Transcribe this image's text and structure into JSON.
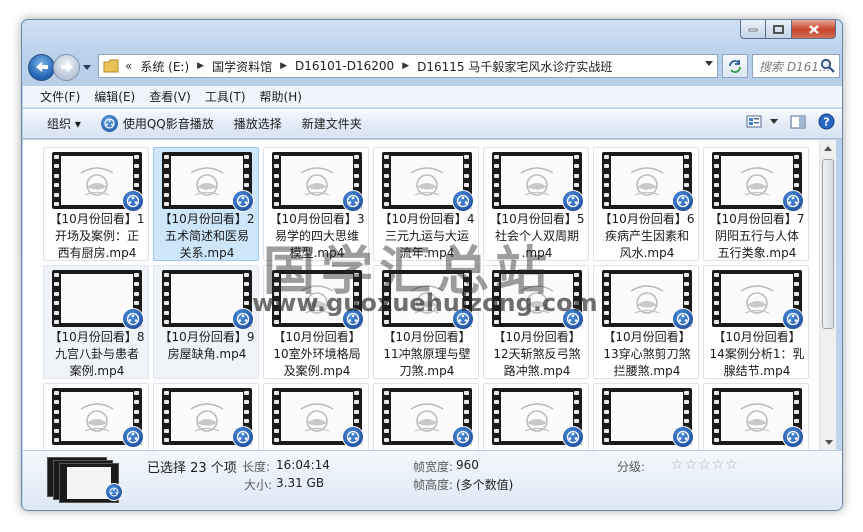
{
  "window": {
    "controls": {
      "minimize": "minimize",
      "maximize": "maximize",
      "close": "close"
    }
  },
  "address": {
    "overflow": "«",
    "crumbs": [
      "系统 (E:)",
      "国学资料馆",
      "D16101-D16200",
      "D16115 马千毅家宅风水诊疗实战班"
    ]
  },
  "search": {
    "placeholder": "搜索 D161..."
  },
  "menu": [
    "文件(F)",
    "编辑(E)",
    "查看(V)",
    "工具(T)",
    "帮助(H)"
  ],
  "toolbar": {
    "organize": "组织 ▾",
    "play_qq": "使用QQ影音播放",
    "play_selection": "播放选择",
    "new_folder": "新建文件夹"
  },
  "files": [
    {
      "name": "【10月份回看】1开场及案例：正西有厨房.mp4",
      "lines": [
        "【10月份回看】1",
        "开场及案例：正",
        "西有厨房.mp4"
      ]
    },
    {
      "name": "【10月份回看】2五术简述和医易关系.mp4",
      "lines": [
        "【10月份回看】2",
        "五术简述和医易",
        "关系.mp4"
      ]
    },
    {
      "name": "【10月份回看】3易学的四大思维模型.mp4",
      "lines": [
        "【10月份回看】3",
        "易学的四大思维",
        "模型.mp4"
      ]
    },
    {
      "name": "【10月份回看】4三元九运与大运流年.mp4",
      "lines": [
        "【10月份回看】4",
        "三元九运与大运",
        "流年.mp4"
      ]
    },
    {
      "name": "【10月份回看】5社会个人双周期.mp4",
      "lines": [
        "【10月份回看】5",
        "社会个人双周期",
        ".mp4"
      ]
    },
    {
      "name": "【10月份回看】6疾病产生因素和风水.mp4",
      "lines": [
        "【10月份回看】6",
        "疾病产生因素和",
        "风水.mp4"
      ]
    },
    {
      "name": "【10月份回看】7阴阳五行与人体五行类象.mp4",
      "lines": [
        "【10月份回看】7",
        "阴阳五行与人体",
        "五行类象.mp4"
      ]
    },
    {
      "name": "【10月份回看】8九宫八卦与患者案例.mp4",
      "lines": [
        "【10月份回看】8",
        "九宫八卦与患者",
        "案例.mp4"
      ]
    },
    {
      "name": "【10月份回看】9房屋缺角.mp4",
      "lines": [
        "【10月份回看】9",
        "房屋缺角.mp4"
      ]
    },
    {
      "name": "【10月份回看】10室外环境格局及案例.mp4",
      "lines": [
        "【10月份回看】",
        "10室外环境格局",
        "及案例.mp4"
      ]
    },
    {
      "name": "【10月份回看】11冲煞原理与壁刀煞.mp4",
      "lines": [
        "【10月份回看】",
        "11冲煞原理与壁",
        "刀煞.mp4"
      ]
    },
    {
      "name": "【10月份回看】12天斩煞反弓煞路冲煞.mp4",
      "lines": [
        "【10月份回看】",
        "12天斩煞反弓煞",
        "路冲煞.mp4"
      ]
    },
    {
      "name": "【10月份回看】13穿心煞剪刀煞拦腰煞.mp4",
      "lines": [
        "【10月份回看】",
        "13穿心煞剪刀煞",
        "拦腰煞.mp4"
      ]
    },
    {
      "name": "【10月份回看】14案例分析1：乳腺结节.mp4",
      "lines": [
        "【10月份回看】",
        "14案例分析1：乳",
        "腺结节.mp4"
      ]
    },
    {
      "name": "",
      "lines": []
    },
    {
      "name": "",
      "lines": []
    },
    {
      "name": "",
      "lines": []
    },
    {
      "name": "",
      "lines": []
    },
    {
      "name": "",
      "lines": []
    },
    {
      "name": "",
      "lines": []
    },
    {
      "name": "",
      "lines": []
    }
  ],
  "watermark": {
    "cn": "国学汇总站",
    "url": "www.guoxuehuizong.com"
  },
  "details": {
    "selected": "已选择 23 个项",
    "length_label": "长度:",
    "length_value": "16:04:14",
    "size_label": "大小:",
    "size_value": "3.31 GB",
    "frame_width_label": "帧宽度:",
    "frame_width_value": "960",
    "frame_height_label": "帧高度:",
    "frame_height_value": "(多个数值)",
    "rating_label": "分级:",
    "rating_value": 0,
    "rating_max": 5
  },
  "colors": {
    "selection": "#cde6f9",
    "accent": "#1c4f9e"
  }
}
